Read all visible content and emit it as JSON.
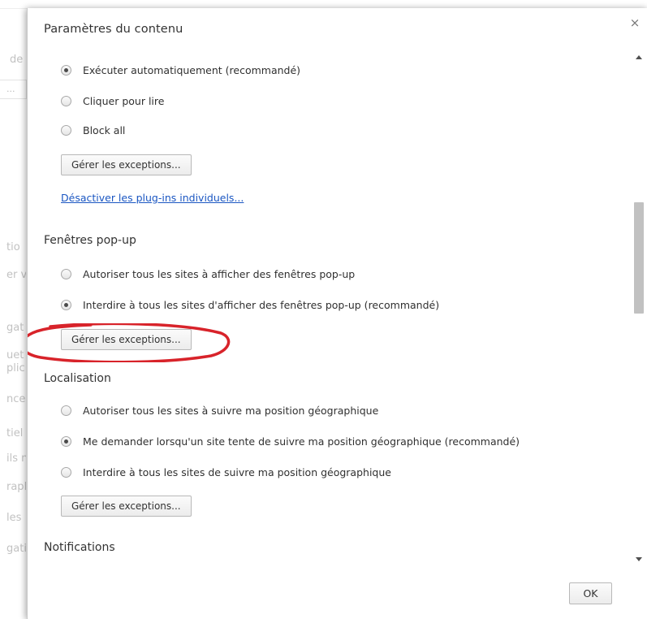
{
  "background": {
    "fragments": [
      "de",
      "...",
      "tio",
      "er v",
      "gat",
      "uet",
      "plic",
      "nce",
      "tiel",
      "ils n",
      "rapl",
      "les",
      "gati"
    ]
  },
  "dialog": {
    "title": "Paramètres du contenu",
    "close_label": "×",
    "ok_label": "OK"
  },
  "plugins": {
    "options": [
      {
        "label": "Exécuter automatiquement (recommandé)",
        "checked": true
      },
      {
        "label": "Cliquer pour lire",
        "checked": false
      },
      {
        "label": "Block all",
        "checked": false
      }
    ],
    "manage_label": "Gérer les exceptions...",
    "disable_link": "Désactiver les plug-ins individuels..."
  },
  "popups": {
    "title": "Fenêtres pop-up",
    "options": [
      {
        "label": "Autoriser tous les sites à afficher des fenêtres pop-up",
        "checked": false
      },
      {
        "label": "Interdire à tous les sites d'afficher des fenêtres pop-up (recommandé)",
        "checked": true
      }
    ],
    "manage_label": "Gérer les exceptions..."
  },
  "location": {
    "title": "Localisation",
    "options": [
      {
        "label": "Autoriser tous les sites à suivre ma position géographique",
        "checked": false
      },
      {
        "label": "Me demander lorsqu'un site tente de suivre ma position géographique (recommandé)",
        "checked": true
      },
      {
        "label": "Interdire à tous les sites de suivre ma position géographique",
        "checked": false
      }
    ],
    "manage_label": "Gérer les exceptions..."
  },
  "notifications": {
    "title": "Notifications"
  },
  "colors": {
    "highlight": "#d8232a",
    "link": "#1a56c2"
  }
}
